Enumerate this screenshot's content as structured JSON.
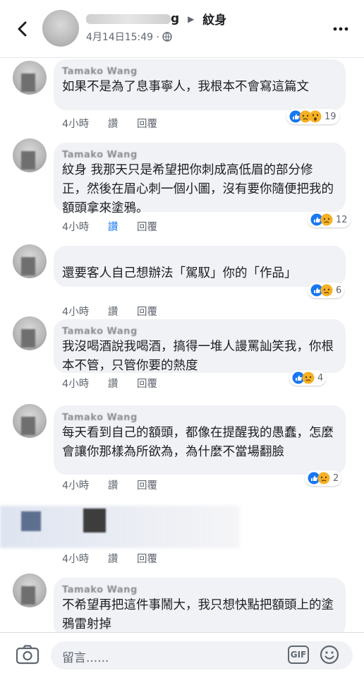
{
  "header": {
    "name_tail": "g",
    "target_name": "紋身",
    "timestamp": "4月14日15:49",
    "separator": "·"
  },
  "comments": [
    {
      "name": "Tamako Wang",
      "text": "如果不是為了息事寧人，我根本不會寫這篇文",
      "time": "4小時",
      "like": "讚",
      "reply": "回覆",
      "reaction_count": "19",
      "reactions": [
        "like-icon",
        "sad-icon",
        "wow-icon"
      ]
    },
    {
      "name": "Tamako Wang",
      "text": "紋身 我那天只是希望把你刺成高低眉的部分修正，然後在眉心刺一個小圖，沒有要你隨便把我的額頭拿來塗鴉。",
      "time": "4小時",
      "like": "讚",
      "reply": "回覆",
      "liked": true,
      "reaction_count": "12",
      "reactions": [
        "like-icon",
        "sad-icon"
      ]
    },
    {
      "name": "",
      "text": "還要客人自己想辦法「駕馭」你的「作品」",
      "time": "4小時",
      "like": "讚",
      "reply": "回覆",
      "reaction_count": "6",
      "reactions": [
        "like-icon",
        "sad-icon"
      ]
    },
    {
      "name": "Tamako Wang",
      "text": "我沒喝酒說我喝酒，搞得一堆人謾罵訕笑我，你根本不管，只管你要的熱度",
      "time": "4小時",
      "like": "讚",
      "reply": "回覆",
      "reaction_count": "4",
      "reactions": [
        "like-icon",
        "sad-icon"
      ]
    },
    {
      "name": "Tamako Wang",
      "text": "每天看到自己的額頭，都像在提醒我的愚蠢，怎麼會讓你那樣為所欲為，為什麼不當場翻臉",
      "time": "4小時",
      "like": "讚",
      "reply": "回覆",
      "reaction_count": "2",
      "reactions": [
        "like-icon",
        "sad-icon"
      ]
    },
    {
      "name": "",
      "text": "",
      "time": "4小時",
      "like": "讚",
      "reply": "回覆"
    },
    {
      "name": "Tamako Wang",
      "text": "不希望再把這件事鬧大，我只想快點把額頭上的塗鴉雷射掉",
      "time": "",
      "like": "",
      "reply": ""
    }
  ],
  "composer": {
    "placeholder": "留言......",
    "gif_label": "GIF"
  },
  "colors": {
    "bubble": "#f0f2f5",
    "link_blue": "#1877f2",
    "meta_gray": "#606770"
  }
}
